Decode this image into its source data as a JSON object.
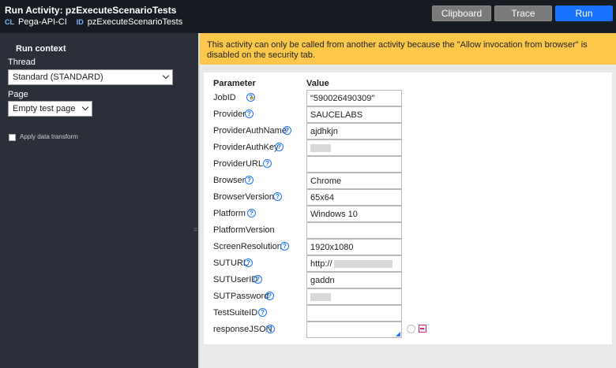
{
  "header": {
    "title": "Run  Activity:  pzExecuteScenarioTests",
    "class_tag": "CL",
    "class_value": "Pega-API-CI",
    "id_tag": "ID",
    "id_value": "pzExecuteScenarioTests",
    "buttons": {
      "clipboard": "Clipboard",
      "trace": "Trace",
      "run": "Run"
    }
  },
  "run_context": {
    "heading": "Run context",
    "thread_label": "Thread",
    "thread_value": "Standard (STANDARD)",
    "page_label": "Page",
    "page_value": "Empty test page",
    "apply_transform_label": "Apply data transform"
  },
  "banner": "This activity can only be called from another activity because the \"Allow invocation from browser\" is disabled on the security tab.",
  "params": {
    "col_parameter": "Parameter",
    "col_value": "Value",
    "help_glyph": "?",
    "required_glyph": "★",
    "rows": [
      {
        "name": "JobID",
        "value": "\"590026490309\"",
        "required": true
      },
      {
        "name": "Provider",
        "value": "SAUCELABS"
      },
      {
        "name": "ProviderAuthName",
        "value": "ajdhkjn"
      },
      {
        "name": "ProviderAuthKey",
        "value": "",
        "redacted": true
      },
      {
        "name": "ProviderURL",
        "value": ""
      },
      {
        "name": "Browser",
        "value": "Chrome"
      },
      {
        "name": "BrowserVersion",
        "value": "65x64"
      },
      {
        "name": "Platform",
        "value": "Windows 10"
      },
      {
        "name": "PlatformVersion",
        "value": ""
      },
      {
        "name": "ScreenResolution",
        "value": "1920x1080"
      },
      {
        "name": "SUTURL",
        "value": "http://",
        "redacted": true
      },
      {
        "name": "SUTUserID",
        "value": "gaddn"
      },
      {
        "name": "SUTPassword",
        "value": "",
        "redacted": true
      },
      {
        "name": "TestSuiteID",
        "value": ""
      },
      {
        "name": "responseJSON",
        "value": "",
        "textarea": true
      }
    ]
  },
  "icons": {
    "help": "help-circle-icon",
    "settings": "gear-icon",
    "expand": "expand-icon",
    "required": "star-icon",
    "dropdown": "chevron-down-icon",
    "splitter": "drag-handle-icon"
  },
  "colors": {
    "accent": "#1a73ff",
    "banner": "#fdc84a",
    "topbar": "#171b22",
    "sidebar": "#2a2f39"
  }
}
